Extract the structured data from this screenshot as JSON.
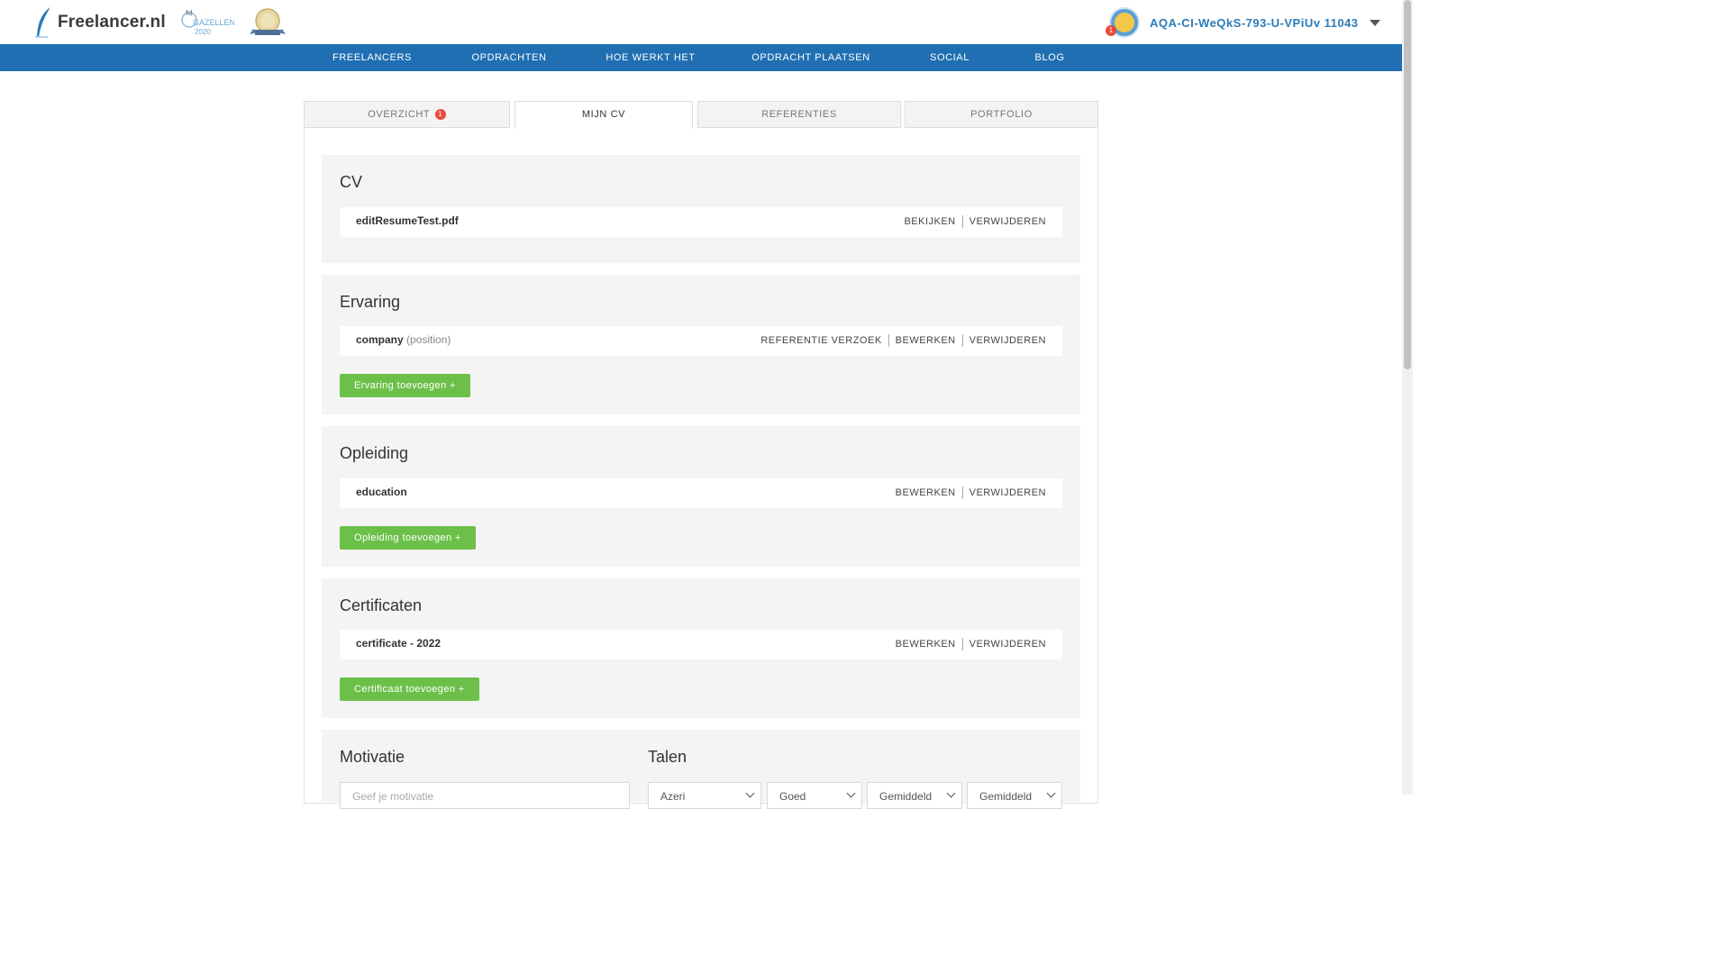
{
  "header": {
    "logo_text": "Freelancer.nl",
    "badge_gazellen_text": "GAZELLEN",
    "badge_gazellen_year": "2020",
    "user": {
      "name": "AQA-CI-WeQkS-793-U-VPiUv 11043",
      "notifications": "1"
    }
  },
  "nav": {
    "items": [
      "FREELANCERS",
      "OPDRACHTEN",
      "HOE WERKT HET",
      "OPDRACHT PLAATSEN",
      "SOCIAL",
      "BLOG"
    ]
  },
  "tabs": {
    "overview": {
      "label": "OVERZICHT",
      "badge": "1"
    },
    "cv": {
      "label": "MIJN CV"
    },
    "references": {
      "label": "REFERENTIES"
    },
    "portfolio": {
      "label": "PORTFOLIO"
    }
  },
  "cv_section": {
    "title": "CV",
    "file": "editResumeTest.pdf",
    "view_label": "BEKIJKEN",
    "delete_label": "VERWIJDEREN"
  },
  "experience": {
    "title": "Ervaring",
    "company": "company",
    "position": "(position)",
    "ref_label": "REFERENTIE VERZOEK",
    "edit_label": "BEWERKEN",
    "delete_label": "VERWIJDEREN",
    "add_label": "Ervaring toevoegen +"
  },
  "education": {
    "title": "Opleiding",
    "item": "education",
    "edit_label": "BEWERKEN",
    "delete_label": "VERWIJDEREN",
    "add_label": "Opleiding toevoegen +"
  },
  "certificates": {
    "title": "Certificaten",
    "item": "certificate - 2022",
    "edit_label": "BEWERKEN",
    "delete_label": "VERWIJDEREN",
    "add_label": "Certificaat toevoegen +"
  },
  "motivation": {
    "title": "Motivatie",
    "placeholder": "Geef je motivatie"
  },
  "languages": {
    "title": "Talen",
    "selects": [
      "Azeri",
      "Goed",
      "Gemiddeld",
      "Gemiddeld"
    ]
  },
  "colors": {
    "nav_blue": "#1f6fb2",
    "user_blue": "#2b7bb9",
    "add_green": "#6cc04a",
    "badge_red": "#e84b3a"
  }
}
